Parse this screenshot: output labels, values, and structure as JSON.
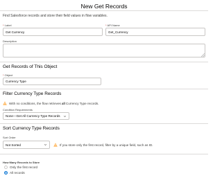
{
  "modal": {
    "title": "New Get Records",
    "description": "Find Salesforce records and store their field values in flow variables."
  },
  "fields": {
    "label_label": "Label",
    "label_value": "Get Currency",
    "api_label": "API Name",
    "api_value": "Get_Currency",
    "description_label": "Description",
    "description_value": ""
  },
  "object_section": {
    "title": "Get Records of This Object",
    "object_label": "Object",
    "object_value": "Currency Type"
  },
  "filter_section": {
    "title": "Filter Currency Type Records",
    "warning_prefix": "With no conditions, the flow retrieves ",
    "warning_bold": "all",
    "warning_suffix": " Currency Type records.",
    "condition_label": "Condition Requirements",
    "condition_value": "None—Get All Currency Type Records"
  },
  "sort_section": {
    "title": "Sort Currency Type Records",
    "sort_label": "Sort Order",
    "sort_value": "Not Sorted",
    "sort_hint": "If you store only the first record, filter by a unique field, such as ID."
  },
  "store_section": {
    "title": "How Many Records to Store",
    "option_first": "Only the first record",
    "option_all": "All records",
    "selected": "All records"
  },
  "colors": {
    "warning": "#ffb75d",
    "brand": "#0070d2",
    "required": "#c23934"
  },
  "icons": [
    "warning-icon",
    "chevron-down-icon"
  ]
}
